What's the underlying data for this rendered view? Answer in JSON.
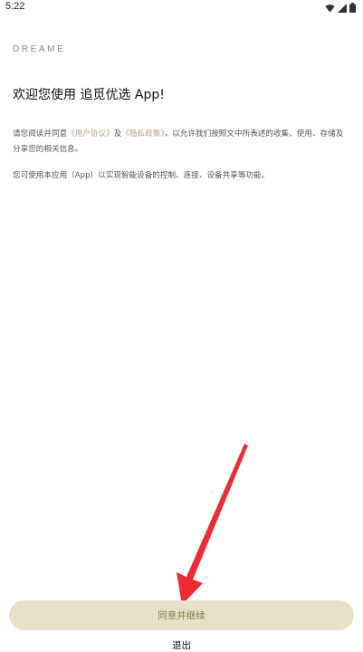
{
  "status_bar": {
    "time": "5:22",
    "icons": [
      "wifi-icon",
      "signal-icon",
      "battery-icon"
    ]
  },
  "brand": "DREAME",
  "title": "欢迎您使用 追觅优选 App!",
  "paragraph1": {
    "prefix": "请您阅读并同意",
    "user_agreement": "《用户协议》",
    "and": "及",
    "privacy_policy": "《隐私政策》",
    "suffix": "，以允许我们按照文中所表述的收集、使用、存储及分享您的相关信息。"
  },
  "paragraph2": "您可使用本应用（App）以实现智能设备的控制、连接、设备共享等功能。",
  "buttons": {
    "agree": "同意并继续",
    "exit": "退出"
  },
  "colors": {
    "accent": "#b69f73",
    "button_bg": "#e8e0c9",
    "arrow": "#ee2a36"
  }
}
